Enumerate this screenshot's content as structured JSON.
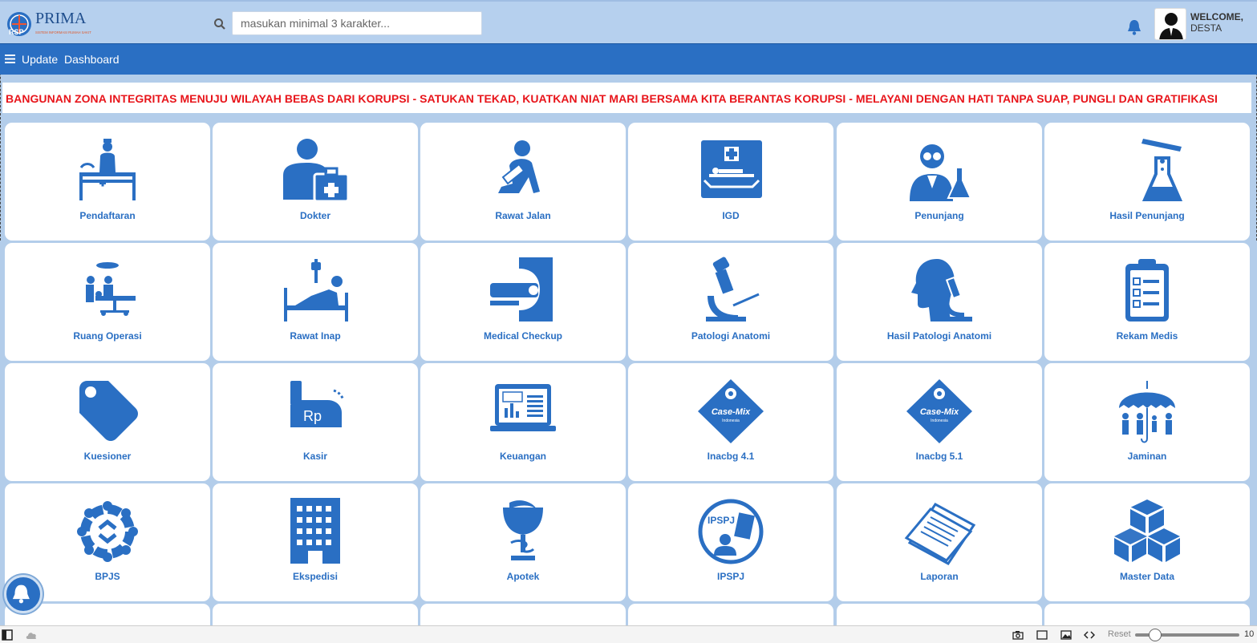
{
  "brand": {
    "name": "PRIMA",
    "tagline": "SISTEM INFORMASI RUMAH SAKIT",
    "badge": "RSP"
  },
  "search": {
    "placeholder": "masukan minimal 3 karakter...",
    "value": ""
  },
  "user": {
    "greeting": "WELCOME,",
    "name": "DESTA"
  },
  "nav": {
    "items": [
      "Update",
      "Dashboard"
    ]
  },
  "announcement": "BANGUNAN ZONA INTEGRITAS MENUJU WILAYAH BEBAS DARI KORUPSI - SATUKAN TEKAD, KUATKAN NIAT MARI BERSAMA KITA BERANTAS KORUPSI - MELAYANI DENGAN HATI TANPA SUAP, PUNGLI DAN GRATIFIKASI",
  "tiles": [
    {
      "label": "Pendaftaran",
      "icon": "reception-desk-icon"
    },
    {
      "label": "Dokter",
      "icon": "doctor-bag-icon"
    },
    {
      "label": "Rawat Jalan",
      "icon": "outpatient-icon"
    },
    {
      "label": "IGD",
      "icon": "emergency-stretcher-icon"
    },
    {
      "label": "Penunjang",
      "icon": "lab-scientist-icon"
    },
    {
      "label": "Hasil Penunjang",
      "icon": "test-tube-flask-icon"
    },
    {
      "label": "Ruang Operasi",
      "icon": "operating-room-icon"
    },
    {
      "label": "Rawat Inap",
      "icon": "hospital-bed-icon"
    },
    {
      "label": "Medical Checkup",
      "icon": "ct-scanner-icon"
    },
    {
      "label": "Patologi Anatomi",
      "icon": "microscope-icon"
    },
    {
      "label": "Hasil Patologi Anatomi",
      "icon": "head-microscope-icon"
    },
    {
      "label": "Rekam Medis",
      "icon": "clipboard-checklist-icon"
    },
    {
      "label": "Kuesioner",
      "icon": "tag-icon"
    },
    {
      "label": "Kasir",
      "icon": "cash-register-icon"
    },
    {
      "label": "Keuangan",
      "icon": "laptop-chart-icon"
    },
    {
      "label": "Inacbg 4.1",
      "icon": "casemix-diamond-icon",
      "badge": "Case-Mix",
      "sub": "Indonesia"
    },
    {
      "label": "Inacbg 5.1",
      "icon": "casemix-diamond-icon",
      "badge": "Case-Mix",
      "sub": "Indonesia"
    },
    {
      "label": "Jaminan",
      "icon": "umbrella-family-icon"
    },
    {
      "label": "BPJS",
      "icon": "bpjs-circle-icon"
    },
    {
      "label": "Ekspedisi",
      "icon": "building-icon"
    },
    {
      "label": "Apotek",
      "icon": "pharmacy-bowl-icon"
    },
    {
      "label": "IPSPJ",
      "icon": "ipspj-circle-icon",
      "badge": "IPSPJ"
    },
    {
      "label": "Laporan",
      "icon": "documents-icon"
    },
    {
      "label": "Master Data",
      "icon": "cubes-icon"
    }
  ],
  "statusbar": {
    "reset_label": "Reset",
    "zoom": "10"
  },
  "colors": {
    "primary": "#2a6fc3",
    "header": "#b6d0ee",
    "background": "#b3cdea",
    "alert": "#e8151b"
  }
}
